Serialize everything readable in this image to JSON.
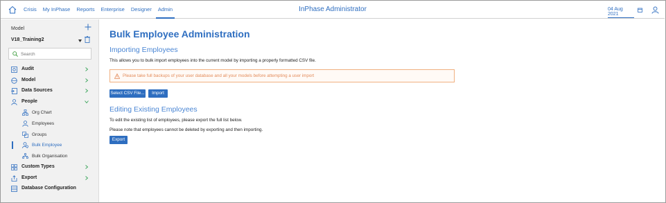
{
  "topbar": {
    "nav": [
      "Crisis",
      "My InPhase",
      "Reports",
      "Enterprise",
      "Designer",
      "Admin"
    ],
    "active_nav": "Admin",
    "title": "InPhase Administrator",
    "date": "04 Aug 2021"
  },
  "sidebar": {
    "model_label": "Model",
    "model_value": "V18_Training2",
    "search_placeholder": "Search",
    "items": {
      "audit": "Audit",
      "model": "Model",
      "data_sources": "Data Sources",
      "people": "People",
      "org_chart": "Org Chart",
      "employees": "Employees",
      "groups": "Groups",
      "bulk_employee": "Bulk Employee",
      "bulk_organisation": "Bulk Organisation",
      "custom_types": "Custom Types",
      "export": "Export",
      "database_configuration": "Database Configuration"
    }
  },
  "main": {
    "title": "Bulk Employee Administration",
    "import_heading": "Importing Employees",
    "import_text": "This allows you to bulk import employees into the current model by importing a properly formatted CSV file.",
    "warning": "Please take full backups of your user database and all your models before attempting a user import",
    "select_csv_label": "Select CSV File...",
    "import_label": "Import",
    "edit_heading": "Editing Existing Employees",
    "edit_text": "To edit the existing list of employees, please export the full list below.",
    "note_text": "Please note that employees cannot be deleted by exporting and then importing.",
    "export_label": "Export"
  },
  "colors": {
    "accent": "#2e6ec0",
    "warning": "#e38b5a",
    "sidebar_bg": "#f1f1f1"
  }
}
